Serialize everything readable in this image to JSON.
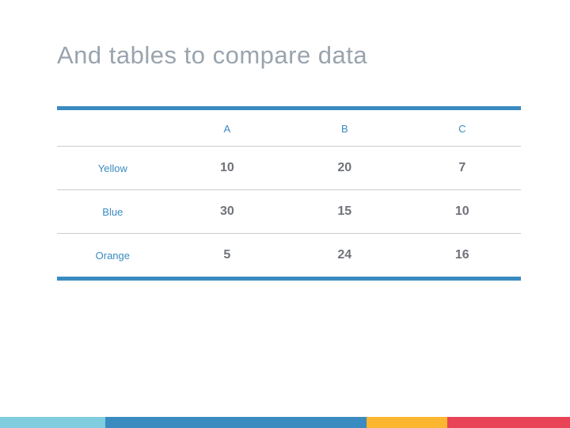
{
  "title": "And tables to compare data",
  "chart_data": {
    "type": "table",
    "title": "And tables to compare data",
    "columns": [
      "A",
      "B",
      "C"
    ],
    "rows": [
      {
        "label": "Yellow",
        "values": [
          10,
          20,
          7
        ]
      },
      {
        "label": "Blue",
        "values": [
          30,
          15,
          10
        ]
      },
      {
        "label": "Orange",
        "values": [
          5,
          24,
          16
        ]
      }
    ]
  },
  "footer_colors": [
    "#81cde0",
    "#3a8bc0",
    "#fdb62f",
    "#e94357"
  ]
}
